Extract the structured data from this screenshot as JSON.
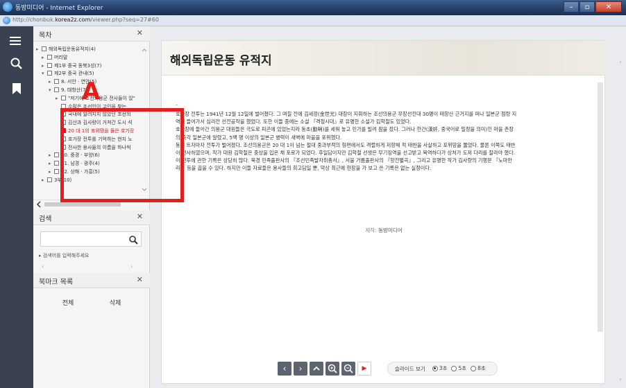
{
  "window": {
    "title": "동방미디어 - Internet Explorer"
  },
  "address": {
    "url_prefix": "http://chonbuk.",
    "url_domain": "korea2z.com",
    "url_suffix": "/viewer.php?seq=27#60"
  },
  "toc": {
    "title": "목차",
    "items": [
      {
        "label": "해외독립운동유적지(4)",
        "level": 0,
        "expander": "▸",
        "box": "▣"
      },
      {
        "label": "머리말",
        "level": 1,
        "expander": "▸",
        "box": "▭"
      },
      {
        "label": "제1부 중국 동북3성(7)",
        "level": 1,
        "expander": "▸",
        "box": "▣"
      },
      {
        "label": "제2부 중국 관내(5)",
        "level": 1,
        "expander": "▾",
        "box": "▣"
      },
      {
        "label": "8. 서안 · 연안(5)",
        "level": 2,
        "expander": "▸",
        "box": "▣"
      },
      {
        "label": "9. 태항산(7)",
        "level": 2,
        "expander": "▾",
        "box": "▣"
      },
      {
        "label": "\"저기에 조선의용군 전사들이 있\"",
        "level": 3,
        "expander": "▸",
        "box": "▭"
      },
      {
        "label": "수많은 조선인이 고인을 찾는",
        "level": 3,
        "expander": "",
        "box": "▭"
      },
      {
        "label": "국내에 알려지지 않았던 조선의",
        "level": 3,
        "expander": "",
        "box": "▭"
      },
      {
        "label": "김산과 김사량이 거쳐간 도시 석",
        "level": 3,
        "expander": "",
        "box": "▭"
      },
      {
        "label": "20 대 1의 포위망을 뚫은 호가장",
        "level": 3,
        "expander": "",
        "box": "▭",
        "active": true
      },
      {
        "label": "호가장 전투를 기억하는 현지 노",
        "level": 3,
        "expander": "",
        "box": "▭"
      },
      {
        "label": "전사한 용사들의 이름을 하나씩",
        "level": 3,
        "expander": "",
        "box": "▭"
      },
      {
        "label": "10. 중경 · 부양(6)",
        "level": 2,
        "expander": "▸",
        "box": "▣"
      },
      {
        "label": "11. 남경 · 광주(4)",
        "level": 2,
        "expander": "▸",
        "box": "▣"
      },
      {
        "label": "12. 상해 · 가흥(5)",
        "level": 2,
        "expander": "▸",
        "box": "▣"
      },
      {
        "label": "3부(10)",
        "level": 1,
        "expander": "▸",
        "box": "▣"
      }
    ]
  },
  "search": {
    "title": "검색",
    "placeholder": "",
    "hint": "검색어를 입력해주세요"
  },
  "bookmarks": {
    "title": "북마크 목록",
    "all_label": "전체",
    "delete_label": "삭제"
  },
  "document": {
    "title": "해외독립운동 유적지",
    "dash": "-",
    "lines": [
      "호가장 전투는 1941년 12월 12일에 벌어졌다. 그 며칠 전에 김세광(金世光) 대장이 지휘하는 조선의용군 무장선전대 30명이 태항산 근거지를 떠나 일본군 점령 지",
      "역에 들어가서 심리전 선전공작을 했었다. 또한 이들 중에는 소설 『격정시대』로 유명한 소설가 김학철도 있었다.",
      "호가장에 들어간 의용군 대원들은 극도로 피곤에 있었는지라 동초(動哨)를 세워 놓고 민가를 빌려 잠을 잤다. 그러나 한간(漢奸, 중국어로 밀정을 의미)인 마을 촌장",
      "의 즉각 일본군에 알렸고, 5백 명 이상의 일본군 병력이 새벽에 마을을 포위했다.",
      "동이 트자마자 전투가 벌어졌다. 조선의용군은 20 대 1이 넘는 절대 중과부적의 형편에서도 격렬하게 저항해 적 태반을 사살하고 포위망을 뚫었다. 물론 이쪽도 태반",
      "이 전사하였으며, 작가 대원 김학철은 중상을 입은 채 포로가 되었다. 후일담이지만 김학철 선생은 무기징역을 선고받고 복역하다가 상처가 도져 다리를 잘라야 했다.",
      "이 전투에 관한 기록은 상당히 많다. 북경 민족출판사의 『조선민족발자취총서』, 서울 거름출판사의 『항전별곡』, 그리고 유명한 작가 김사량의 기행문 『노마만",
      "리』 등을 꼽을 수 있다. 하지만 이들 자료들은 용사들의 회고담일 뿐, 막상 최근에 현장을 가 보고 쓴 기록은 없는 실정이다."
    ],
    "credit_label": "제작:",
    "credit_value": "동방미디어"
  },
  "slideshow": {
    "label": "슬라이드 보기",
    "options": [
      {
        "label": "3초",
        "selected": true
      },
      {
        "label": "5초",
        "selected": false
      },
      {
        "label": "8초",
        "selected": false
      }
    ]
  },
  "annotation": {
    "letter": "A"
  },
  "colors": {
    "annotation_red": "#e1201e",
    "sidebar_dark": "#3a4150",
    "active_item": "#dd1122"
  }
}
